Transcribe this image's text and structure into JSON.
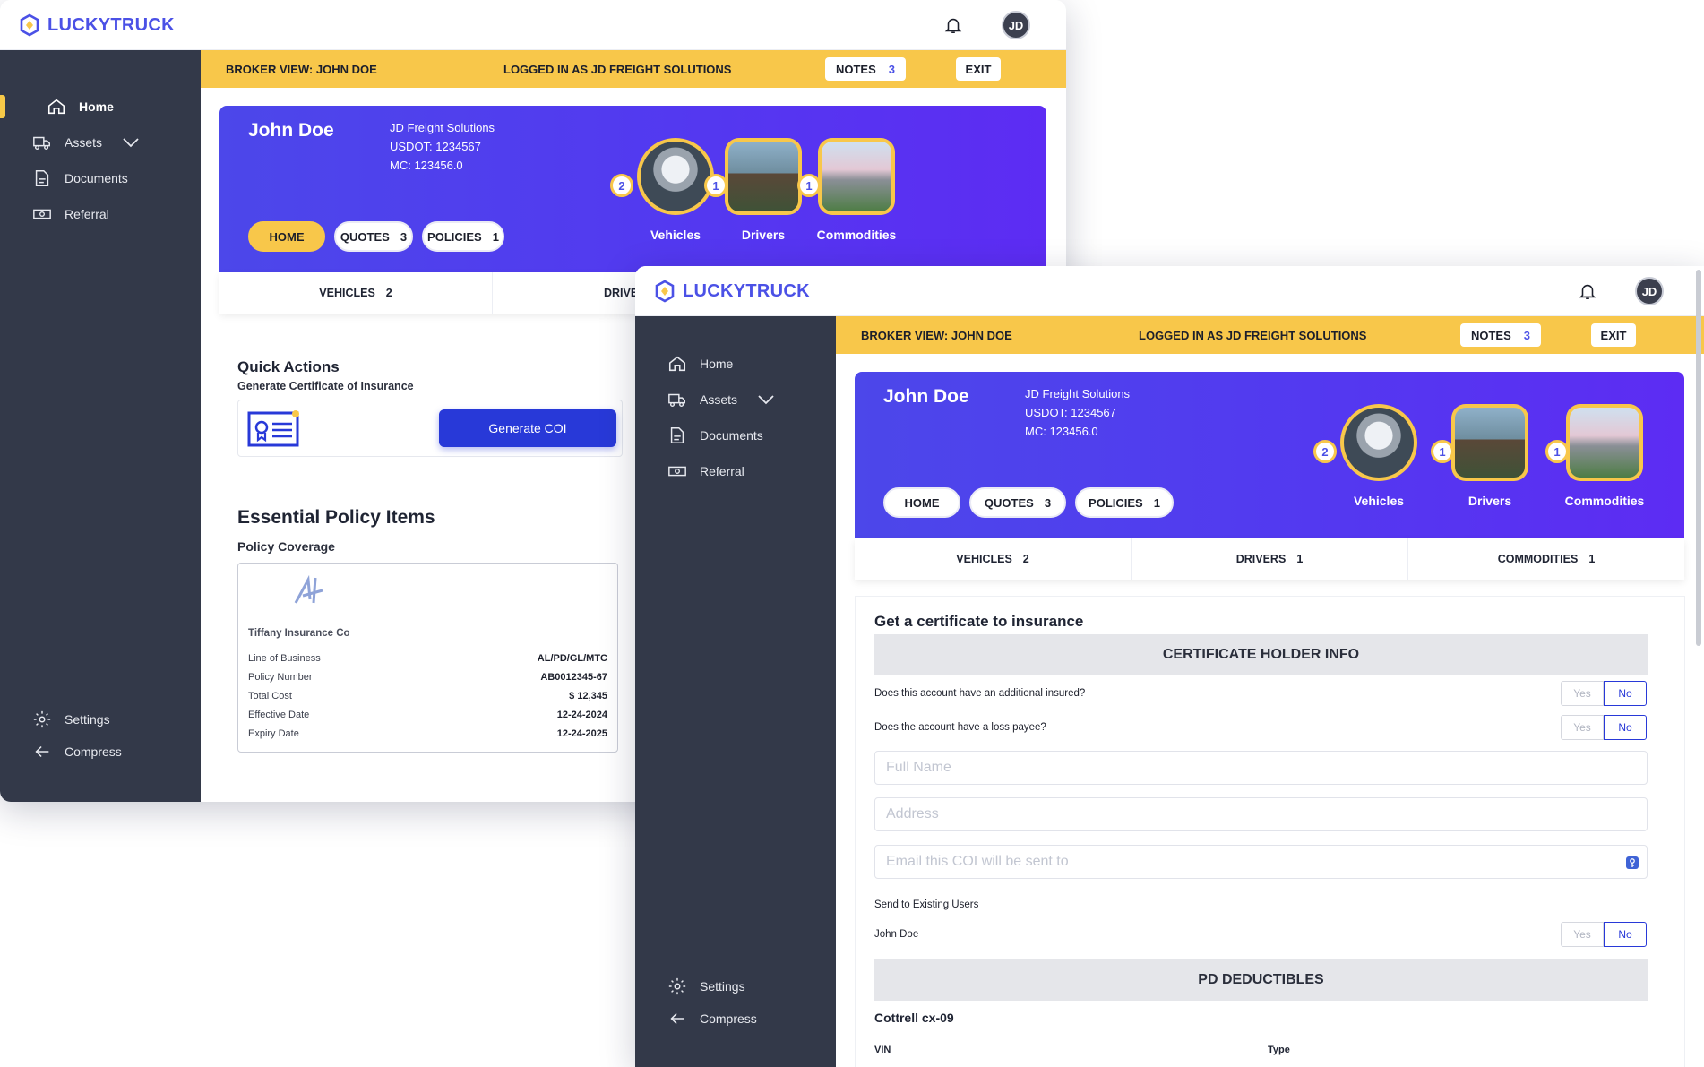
{
  "brand": "LUCKYTRUCK",
  "user_initials": "JD",
  "sidebar": {
    "items": [
      {
        "label": "Home",
        "icon": "home-icon"
      },
      {
        "label": "Assets",
        "icon": "truck-icon"
      },
      {
        "label": "Documents",
        "icon": "document-icon"
      },
      {
        "label": "Referral",
        "icon": "money-icon"
      }
    ],
    "settings": "Settings",
    "compress": "Compress"
  },
  "banner": {
    "broker_view": "BROKER VIEW: JOHN DOE",
    "logged_in": "LOGGED IN AS JD FREIGHT SOLUTIONS",
    "notes_label": "NOTES",
    "notes_count": "3",
    "exit": "EXIT"
  },
  "profile": {
    "name": "John Doe",
    "company": "JD Freight Solutions",
    "usdot": "USDOT: 1234567",
    "mc": "MC: 123456.0"
  },
  "hero_buttons": {
    "home": "HOME",
    "quotes": "QUOTES",
    "quotes_count": "3",
    "policies": "POLICIES",
    "policies_count": "1"
  },
  "tiles": [
    {
      "label": "Vehicles",
      "count": "2"
    },
    {
      "label": "Drivers",
      "count": "1"
    },
    {
      "label": "Commodities",
      "count": "1"
    }
  ],
  "tabs": [
    {
      "label": "VEHICLES",
      "count": "2"
    },
    {
      "label": "DRIVERS",
      "count": "1"
    },
    {
      "label": "COMMODITIES",
      "count": "1"
    }
  ],
  "tab_drivers_truncated": "DRIVE",
  "quick_actions": {
    "title": "Quick Actions",
    "subtitle": "Generate Certificate of Insurance",
    "button": "Generate COI"
  },
  "policy_items": {
    "title": "Essential Policy Items",
    "subtitle": "Policy Coverage",
    "insurer": "Tiffany Insurance Co",
    "rows": [
      {
        "k": "Line of Business",
        "v": "AL/PD/GL/MTC"
      },
      {
        "k": "Policy Number",
        "v": "AB0012345-67"
      },
      {
        "k": "Total Cost",
        "v": "$ 12,345"
      },
      {
        "k": "Effective Date",
        "v": "12-24-2024"
      },
      {
        "k": "Expiry Date",
        "v": "12-24-2025"
      }
    ]
  },
  "coi_form": {
    "title": "Get a certificate to insurance",
    "section1": "CERTIFICATE HOLDER INFO",
    "q1": "Does this account have an additional insured?",
    "q2": "Does the account have a loss payee?",
    "yes": "Yes",
    "no": "No",
    "full_name_placeholder": "Full Name",
    "address_placeholder": "Address",
    "email_placeholder": "Email this COI will be sent to",
    "send_existing": "Send to Existing Users",
    "existing_user": "John Doe",
    "section2": "PD DEDUCTIBLES",
    "vehicle": "Cottrell cx-09",
    "col_vin": "VIN",
    "col_type": "Type"
  },
  "colors": {
    "accent": "#4b51e6",
    "yellow": "#f8c74a",
    "sidebar": "#333949",
    "primary_button": "#2839d8"
  }
}
